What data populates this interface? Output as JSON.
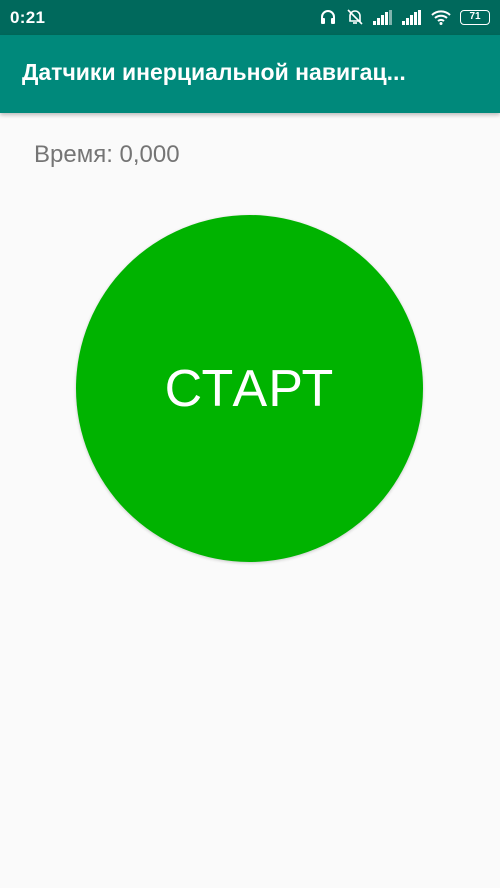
{
  "status_bar": {
    "time": "0:21",
    "battery": "71",
    "icons": [
      "headphones-icon",
      "notifications-off-icon",
      "signal-icon",
      "signal-icon",
      "wifi-icon",
      "battery-icon"
    ]
  },
  "app_bar": {
    "title": "Датчики инерциальной навигац..."
  },
  "main": {
    "time_label": "Время: 0,000",
    "start_button_label": "СТАРТ"
  },
  "colors": {
    "status_bar": "#00695c",
    "app_bar": "#00897b",
    "start_button": "#00b300",
    "background": "#fafafa"
  }
}
